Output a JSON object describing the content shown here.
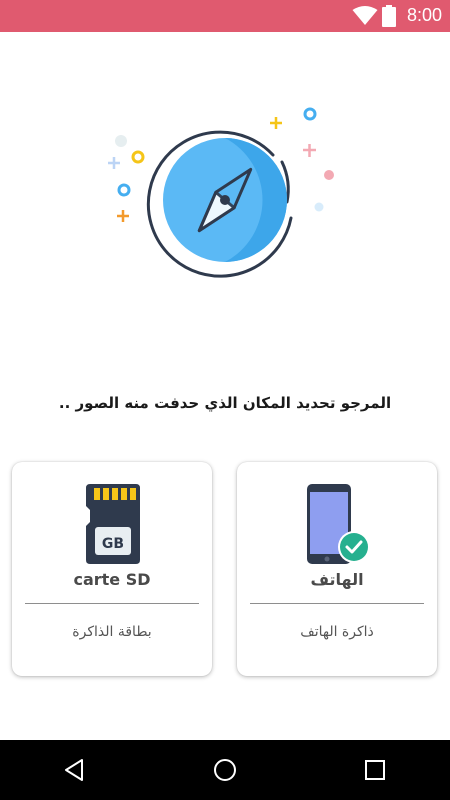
{
  "status_bar": {
    "time": "8:00",
    "background": "#e05a6f",
    "icons": [
      "wifi-icon",
      "battery-icon"
    ]
  },
  "hero": {
    "icon": "compass-icon",
    "accent": "#5bb9f5"
  },
  "message": "المرجو تحديد المكان الذي حدفت منه الصور ..",
  "cards": {
    "sd": {
      "title": "carte SD",
      "subtitle": "بطاقة الذاكرة",
      "badge": "GB",
      "icon": "sd-card-icon"
    },
    "phone": {
      "title": "الهاتف",
      "subtitle": "ذاكرة الهاتف",
      "icon": "phone-icon",
      "check_color": "#26b08f"
    }
  },
  "nav_bar": {
    "icons": [
      "back-icon",
      "home-icon",
      "recents-icon"
    ]
  }
}
